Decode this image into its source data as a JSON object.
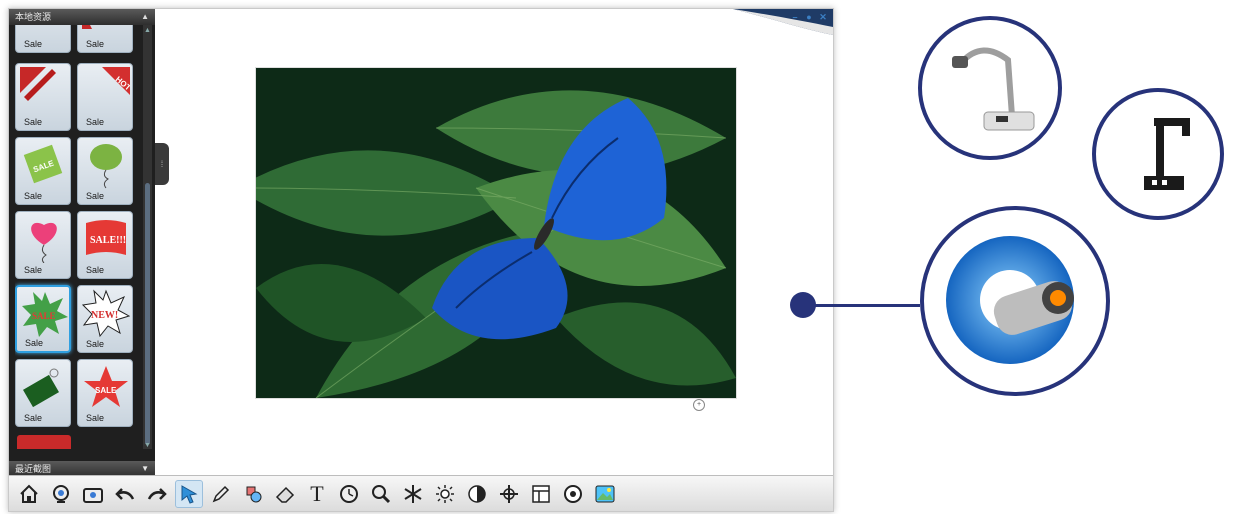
{
  "app": {
    "panel_title": "本地资源",
    "panel_footer": "最近截图",
    "tiles": [
      {
        "label": "Sale"
      },
      {
        "label": "Sale"
      },
      {
        "label": "Sale"
      },
      {
        "label": "Sale"
      },
      {
        "label": "Sale"
      },
      {
        "label": "Sale"
      },
      {
        "label": "Sale"
      },
      {
        "label": "Sale"
      },
      {
        "label": "Sale"
      },
      {
        "label": "Sale"
      },
      {
        "label": "Sale"
      },
      {
        "label": "Sale"
      }
    ],
    "tile_art_text": [
      "HOT",
      "SALE",
      "SALE!!!",
      "SALE",
      "NEW!",
      "SALE"
    ],
    "selected_tile_index": 8
  },
  "toolbar": {
    "items": [
      {
        "name": "home-icon"
      },
      {
        "name": "camera-icon"
      },
      {
        "name": "capture-icon"
      },
      {
        "name": "undo-icon"
      },
      {
        "name": "redo-icon"
      },
      {
        "name": "pointer-icon",
        "active": true
      },
      {
        "name": "pen-icon"
      },
      {
        "name": "shapes-icon"
      },
      {
        "name": "eraser-icon"
      },
      {
        "name": "text-icon",
        "glyph": "T"
      },
      {
        "name": "timer-icon"
      },
      {
        "name": "zoom-icon"
      },
      {
        "name": "freeze-icon"
      },
      {
        "name": "brightness-icon"
      },
      {
        "name": "contrast-icon"
      },
      {
        "name": "focus-icon"
      },
      {
        "name": "layout-icon"
      },
      {
        "name": "rotate-icon"
      },
      {
        "name": "gallery-icon"
      }
    ]
  },
  "colors": {
    "accent_navy": "#27337a",
    "selection_blue": "#2f9fe0",
    "panel_dark": "#1f1f1f"
  },
  "callouts": [
    {
      "name": "document-camera-device"
    },
    {
      "name": "mini-document-camera-device"
    },
    {
      "name": "camera-app-logo"
    }
  ]
}
